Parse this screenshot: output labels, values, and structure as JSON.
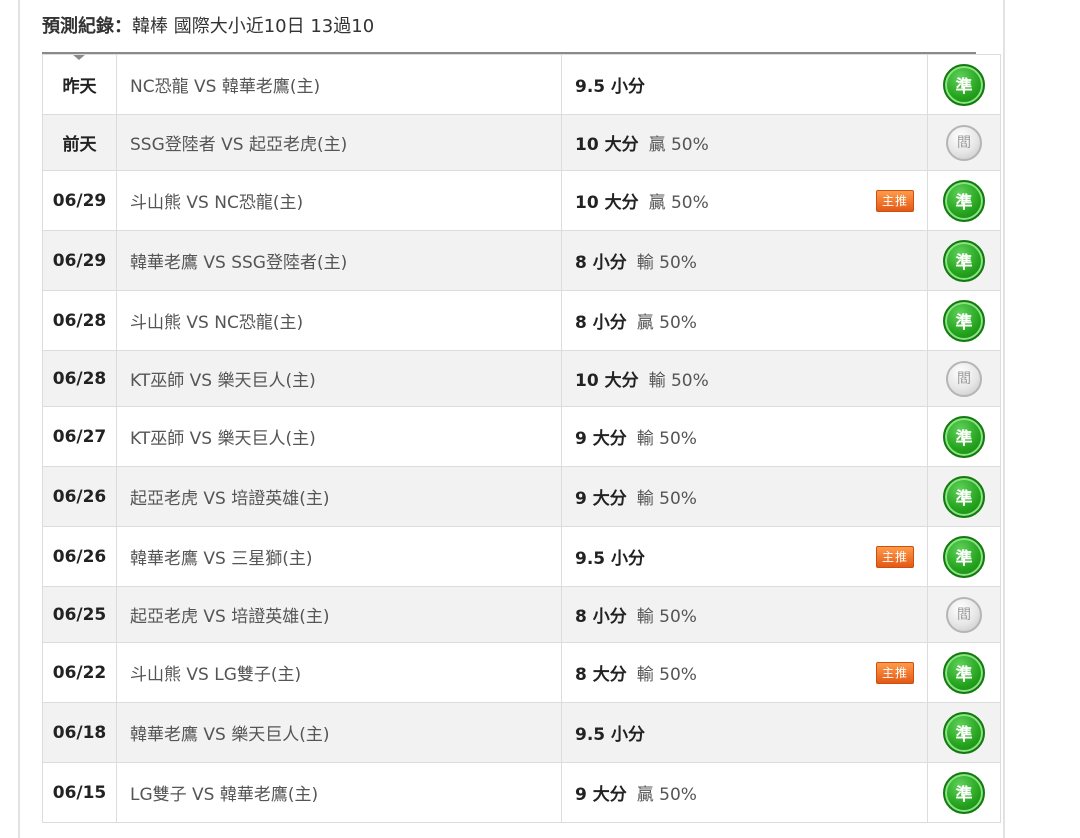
{
  "header": {
    "label": "預測紀錄：",
    "summary": "韓棒 國際大小近10日 13過10"
  },
  "records": [
    {
      "date": "昨天",
      "match": "NC恐龍 VS 韓華老鷹(主)",
      "pick": "9.5 小分",
      "odds": "",
      "hot": "",
      "result": "準",
      "result_type": "win"
    },
    {
      "date": "前天",
      "match": "SSG登陸者 VS 起亞老虎(主)",
      "pick": "10 大分",
      "odds": "贏 50%",
      "hot": "",
      "result": "閻",
      "result_type": "draw"
    },
    {
      "date": "06/29",
      "match": "斗山熊 VS NC恐龍(主)",
      "pick": "10 大分",
      "odds": "贏 50%",
      "hot": "主推",
      "result": "準",
      "result_type": "win"
    },
    {
      "date": "06/29",
      "match": "韓華老鷹 VS SSG登陸者(主)",
      "pick": "8 小分",
      "odds": "輸 50%",
      "hot": "",
      "result": "準",
      "result_type": "win"
    },
    {
      "date": "06/28",
      "match": "斗山熊 VS NC恐龍(主)",
      "pick": "8 小分",
      "odds": "贏 50%",
      "hot": "",
      "result": "準",
      "result_type": "win"
    },
    {
      "date": "06/28",
      "match": "KT巫師 VS 樂天巨人(主)",
      "pick": "10 大分",
      "odds": "輸 50%",
      "hot": "",
      "result": "閻",
      "result_type": "draw"
    },
    {
      "date": "06/27",
      "match": "KT巫師 VS 樂天巨人(主)",
      "pick": "9 大分",
      "odds": "輸 50%",
      "hot": "",
      "result": "準",
      "result_type": "win"
    },
    {
      "date": "06/26",
      "match": "起亞老虎 VS 培證英雄(主)",
      "pick": "9 大分",
      "odds": "輸 50%",
      "hot": "",
      "result": "準",
      "result_type": "win"
    },
    {
      "date": "06/26",
      "match": "韓華老鷹 VS 三星獅(主)",
      "pick": "9.5 小分",
      "odds": "",
      "hot": "主推",
      "result": "準",
      "result_type": "win"
    },
    {
      "date": "06/25",
      "match": "起亞老虎 VS 培證英雄(主)",
      "pick": "8 小分",
      "odds": "輸 50%",
      "hot": "",
      "result": "閻",
      "result_type": "draw"
    },
    {
      "date": "06/22",
      "match": "斗山熊 VS LG雙子(主)",
      "pick": "8 大分",
      "odds": "輸 50%",
      "hot": "主推",
      "result": "準",
      "result_type": "win"
    },
    {
      "date": "06/18",
      "match": "韓華老鷹 VS 樂天巨人(主)",
      "pick": "9.5 小分",
      "odds": "",
      "hot": "",
      "result": "準",
      "result_type": "win"
    },
    {
      "date": "06/15",
      "match": "LG雙子 VS 韓華老鷹(主)",
      "pick": "9 大分",
      "odds": "贏 50%",
      "hot": "",
      "result": "準",
      "result_type": "win"
    }
  ],
  "colors": {
    "win_badge": "#26a51f",
    "draw_badge": "#c4c4c4",
    "hot_tag": "#e35a16",
    "alt_row": "#f2f2f2"
  }
}
